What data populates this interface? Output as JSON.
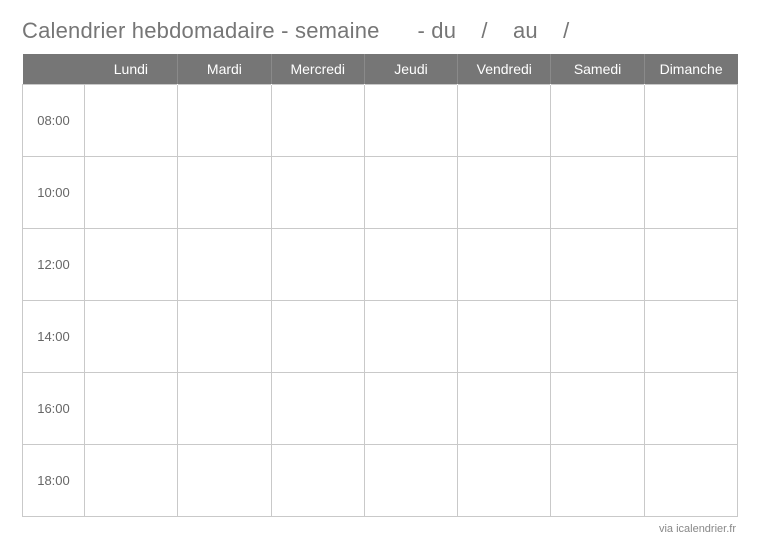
{
  "title": "Calendrier hebdomadaire - semaine      - du    /    au    / ",
  "days": {
    "blank": "",
    "d1": "Lundi",
    "d2": "Mardi",
    "d3": "Mercredi",
    "d4": "Jeudi",
    "d5": "Vendredi",
    "d6": "Samedi",
    "d7": "Dimanche"
  },
  "times": {
    "t1": "08:00",
    "t2": "10:00",
    "t3": "12:00",
    "t4": "14:00",
    "t5": "16:00",
    "t6": "18:00"
  },
  "footer": "via icalendrier.fr"
}
